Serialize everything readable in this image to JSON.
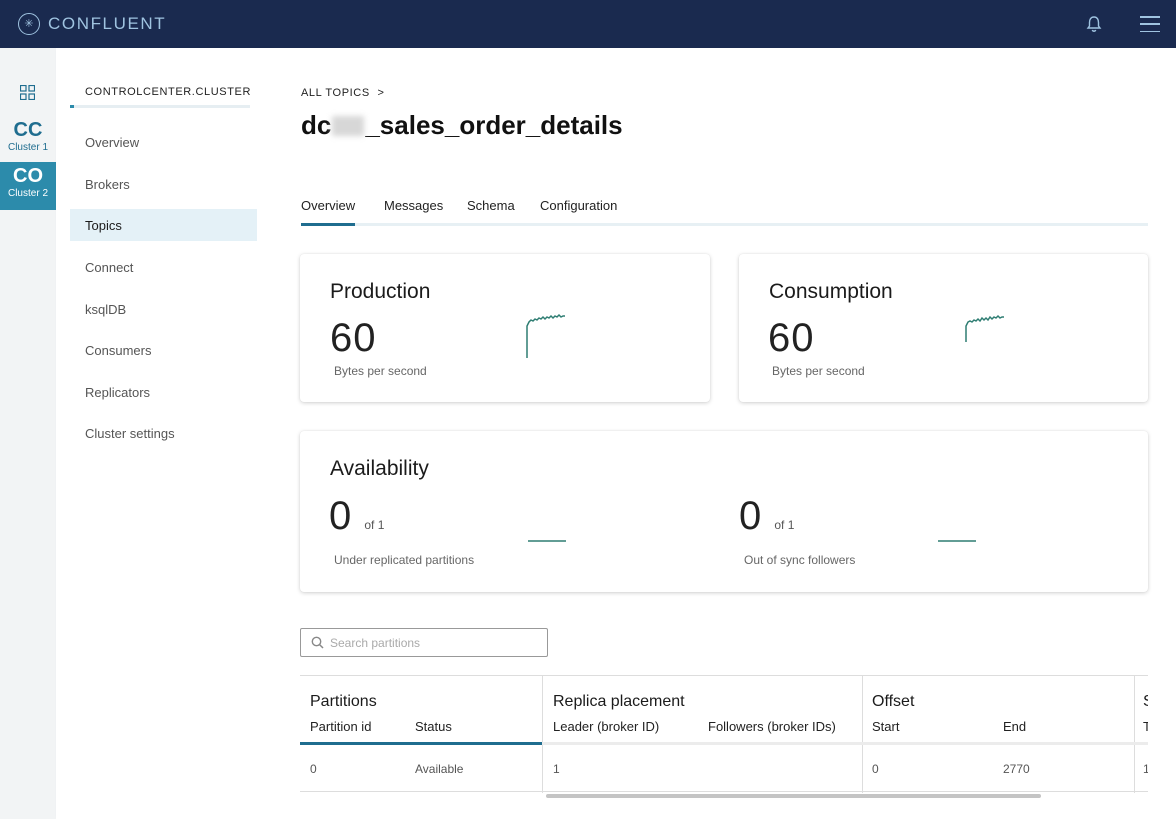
{
  "app": {
    "brand": "CONFLUENT"
  },
  "clusters": [
    {
      "abbr": "CC",
      "label": "Cluster 1"
    },
    {
      "abbr": "CO",
      "label": "Cluster 2"
    }
  ],
  "nav": {
    "title": "CONTROLCENTER.CLUSTER",
    "items": [
      "Overview",
      "Brokers",
      "Topics",
      "Connect",
      "ksqlDB",
      "Consumers",
      "Replicators",
      "Cluster settings"
    ],
    "active": "Topics"
  },
  "page": {
    "breadcrumb": "ALL TOPICS",
    "breadcrumb_sep": ">",
    "title_prefix": "dc",
    "title_suffix": "_sales_order_details"
  },
  "tabs": [
    "Overview",
    "Messages",
    "Schema",
    "Configuration"
  ],
  "production": {
    "title": "Production",
    "value": "60",
    "unit": "Bytes per second"
  },
  "consumption": {
    "title": "Consumption",
    "value": "60",
    "unit": "Bytes per second"
  },
  "availability": {
    "title": "Availability",
    "under_replicated": {
      "value": "0",
      "of": "of 1",
      "label": "Under replicated partitions"
    },
    "out_of_sync": {
      "value": "0",
      "of": "of 1",
      "label": "Out of sync followers"
    }
  },
  "search": {
    "placeholder": "Search partitions"
  },
  "table": {
    "groups": [
      "Partitions",
      "Replica placement",
      "Offset",
      "S"
    ],
    "columns": {
      "partition_id": "Partition id",
      "status": "Status",
      "leader": "Leader (broker ID)",
      "followers": "Followers (broker IDs)",
      "start": "Start",
      "end": "End",
      "extra": "T"
    },
    "rows": [
      {
        "partition_id": "0",
        "status": "Available",
        "leader": "1",
        "followers": "",
        "start": "0",
        "end": "2770",
        "extra": "1"
      }
    ]
  },
  "colors": {
    "topbar": "#1a2a4f",
    "accent": "#2c8bab",
    "sparkline": "#2e7d72"
  }
}
